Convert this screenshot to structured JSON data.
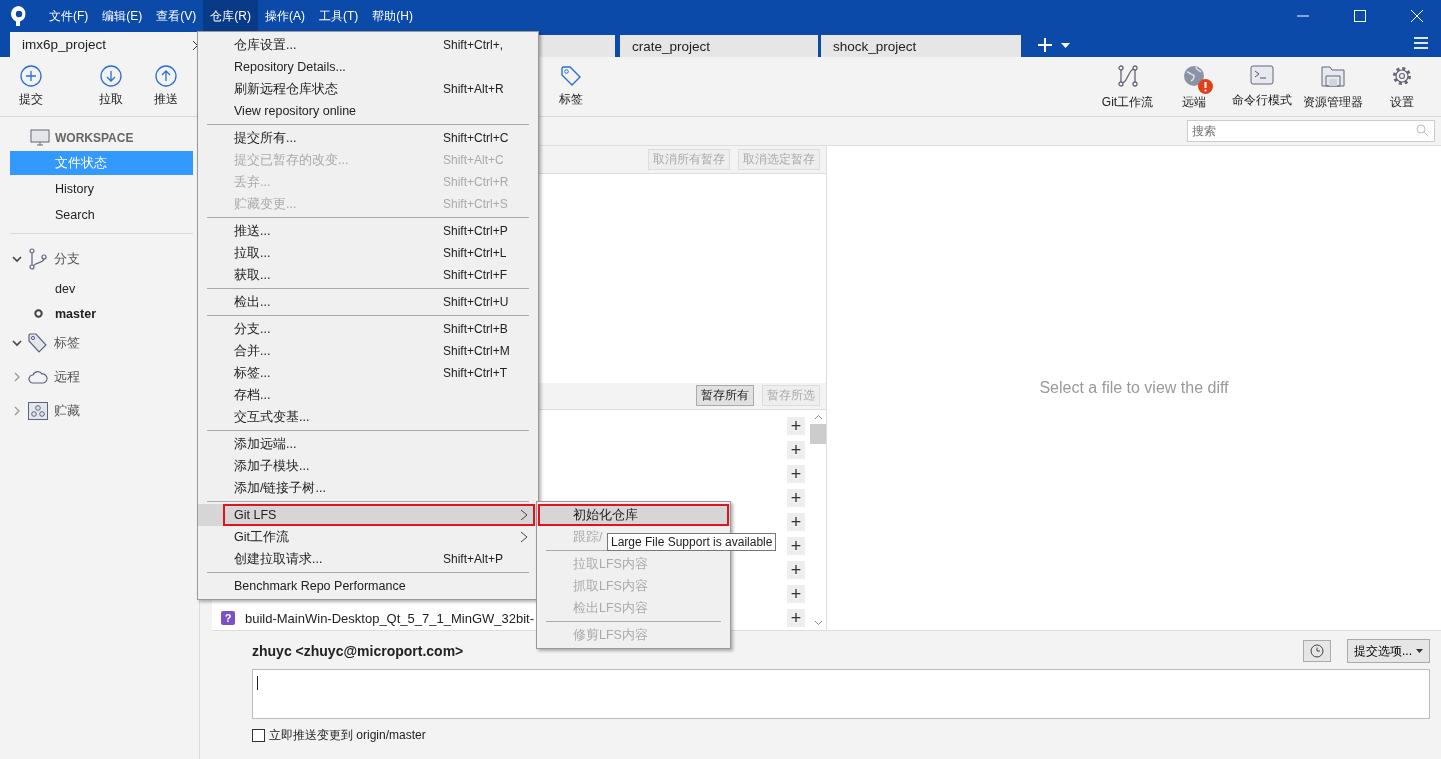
{
  "menubar": [
    {
      "label": "文件(F)",
      "selected": false
    },
    {
      "label": "编辑(E)",
      "selected": false
    },
    {
      "label": "查看(V)",
      "selected": false
    },
    {
      "label": "仓库(R)",
      "selected": true
    },
    {
      "label": "操作(A)",
      "selected": false
    },
    {
      "label": "工具(T)",
      "selected": false
    },
    {
      "label": "帮助(H)",
      "selected": false
    }
  ],
  "tabs": [
    {
      "label": "imx6p_project",
      "selected": true
    },
    {
      "selected": false
    },
    {
      "label": "crate_project",
      "selected": false
    },
    {
      "label": "shock_project",
      "selected": false
    }
  ],
  "toolbar_left": [
    {
      "label": "提交",
      "kind": "commit"
    },
    {
      "label": "拉取",
      "kind": "pull"
    },
    {
      "label": "推送",
      "kind": "push"
    },
    {
      "label": "标签",
      "kind": "tag"
    }
  ],
  "toolbar_right": [
    {
      "label": "Git工作流",
      "kind": "flow",
      "alert": false
    },
    {
      "label": "远端",
      "kind": "globe",
      "alert": true
    },
    {
      "label": "命令行模式",
      "kind": "terminal",
      "alert": false
    },
    {
      "label": "资源管理器",
      "kind": "folder",
      "alert": false
    },
    {
      "label": "设置",
      "kind": "settings",
      "alert": false
    }
  ],
  "search": {
    "placeholder": "搜索"
  },
  "sidebar": {
    "workspace": {
      "title": "WORKSPACE",
      "items": [
        {
          "label": "文件状态",
          "selected": true
        },
        {
          "label": "History",
          "selected": false
        },
        {
          "label": "Search",
          "selected": false
        }
      ]
    },
    "groups": [
      {
        "label": "分支",
        "kind": "branches",
        "expanded": true,
        "children": [
          {
            "label": "dev",
            "current": false
          },
          {
            "label": "master",
            "current": true
          }
        ]
      },
      {
        "label": "标签",
        "kind": "tags",
        "expanded": true
      },
      {
        "label": "远程",
        "kind": "remotes",
        "expanded": false
      },
      {
        "label": "贮藏",
        "kind": "stashes",
        "expanded": false
      }
    ]
  },
  "staged": {
    "buttons": [
      {
        "label": "取消所有暂存",
        "disabled": true
      },
      {
        "label": "取消选定暂存",
        "disabled": true
      }
    ]
  },
  "unstaged": {
    "buttons": [
      {
        "label": "暂存所有",
        "disabled": false
      },
      {
        "label": "暂存所选",
        "disabled": true
      }
    ],
    "rows": [
      {
        "action": "+"
      },
      {
        "action": "+"
      },
      {
        "action": "+"
      },
      {
        "action": "+"
      },
      {
        "action": "+"
      },
      {
        "action": "+"
      },
      {
        "action": "+"
      },
      {
        "action": "+"
      },
      {
        "status": "?",
        "name": "build-MainWin-Desktop_Qt_5_7_1_MinGW_32bit-",
        "action": "+"
      }
    ]
  },
  "diff": {
    "placeholder": "Select a file to view the diff"
  },
  "commit": {
    "author": "zhuyc <zhuyc@microport.com>",
    "options": "提交选项...",
    "push_label": "立即推送变更到 origin/master",
    "push_checked": false
  },
  "menu": [
    {
      "kind": "item",
      "label": "仓库设置...",
      "shortcut": "Shift+Ctrl+,",
      "disabled": false
    },
    {
      "kind": "item",
      "label": "Repository Details...",
      "disabled": false
    },
    {
      "kind": "item",
      "label": "刷新远程仓库状态",
      "shortcut": "Shift+Alt+R",
      "disabled": false
    },
    {
      "kind": "item",
      "label": "View repository online",
      "disabled": false
    },
    {
      "kind": "separator"
    },
    {
      "kind": "item",
      "label": "提交所有...",
      "shortcut": "Shift+Ctrl+C",
      "disabled": false
    },
    {
      "kind": "item",
      "label": "提交已暂存的改变...",
      "shortcut": "Shift+Alt+C",
      "disabled": true
    },
    {
      "kind": "item",
      "label": "丢弃...",
      "shortcut": "Shift+Ctrl+R",
      "disabled": true
    },
    {
      "kind": "item",
      "label": "贮藏变更...",
      "shortcut": "Shift+Ctrl+S",
      "disabled": true
    },
    {
      "kind": "separator"
    },
    {
      "kind": "item",
      "label": "推送...",
      "shortcut": "Shift+Ctrl+P",
      "disabled": false
    },
    {
      "kind": "item",
      "label": "拉取...",
      "shortcut": "Shift+Ctrl+L",
      "disabled": false
    },
    {
      "kind": "item",
      "label": "获取...",
      "shortcut": "Shift+Ctrl+F",
      "disabled": false
    },
    {
      "kind": "separator"
    },
    {
      "kind": "item",
      "label": "检出...",
      "shortcut": "Shift+Ctrl+U",
      "disabled": false
    },
    {
      "kind": "separator"
    },
    {
      "kind": "item",
      "label": "分支...",
      "shortcut": "Shift+Ctrl+B",
      "disabled": false
    },
    {
      "kind": "item",
      "label": "合并...",
      "shortcut": "Shift+Ctrl+M",
      "disabled": false
    },
    {
      "kind": "item",
      "label": "标签...",
      "shortcut": "Shift+Ctrl+T",
      "disabled": false
    },
    {
      "kind": "item",
      "label": "存档...",
      "disabled": false
    },
    {
      "kind": "item",
      "label": "交互式变基...",
      "disabled": false
    },
    {
      "kind": "separator"
    },
    {
      "kind": "item",
      "label": "添加远端...",
      "disabled": false
    },
    {
      "kind": "item",
      "label": "添加子模块...",
      "disabled": false
    },
    {
      "kind": "item",
      "label": "添加/链接子树...",
      "disabled": false
    },
    {
      "kind": "separator"
    },
    {
      "kind": "item",
      "label": "Git LFS",
      "disabled": false,
      "submenu": true,
      "highlighted": true,
      "annotated": true
    },
    {
      "kind": "item",
      "label": "Git工作流",
      "disabled": false,
      "submenu": true
    },
    {
      "kind": "item",
      "label": "创建拉取请求...",
      "shortcut": "Shift+Alt+P",
      "disabled": false
    },
    {
      "kind": "separator"
    },
    {
      "kind": "item",
      "label": "Benchmark Repo Performance",
      "disabled": false
    }
  ],
  "submenu": [
    {
      "kind": "item",
      "label": "初始化仓库",
      "disabled": false,
      "highlighted": true,
      "annotated": true
    },
    {
      "kind": "item",
      "label": "跟踪/",
      "disabled": true
    },
    {
      "kind": "separator"
    },
    {
      "kind": "item",
      "label": "拉取LFS内容",
      "disabled": true
    },
    {
      "kind": "item",
      "label": "抓取LFS内容",
      "disabled": true
    },
    {
      "kind": "item",
      "label": "检出LFS内容",
      "disabled": true
    },
    {
      "kind": "separator"
    },
    {
      "kind": "item",
      "label": "修剪LFS内容",
      "disabled": true
    }
  ],
  "tooltip": "Large File Support is available"
}
